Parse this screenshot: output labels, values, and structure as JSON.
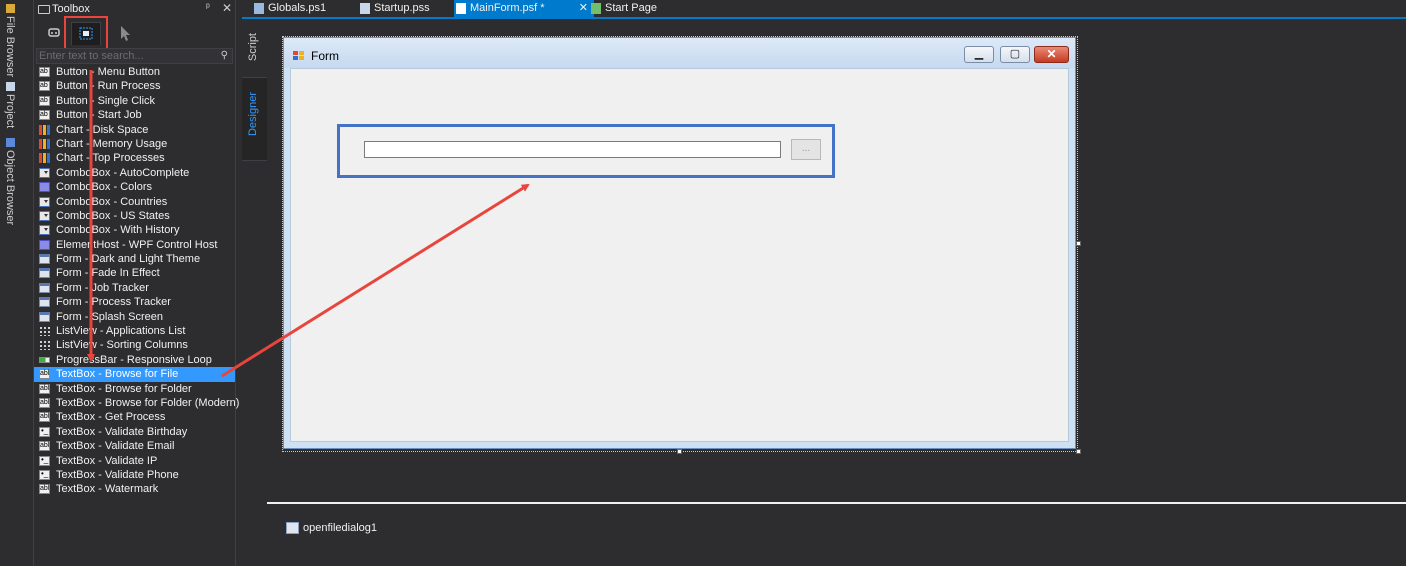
{
  "left_strip": {
    "file_browser": "File Browser",
    "project": "Project",
    "object_browser": "Object Browser"
  },
  "toolbox": {
    "title": "Toolbox",
    "pin_glyph": "ᵖ",
    "close_glyph": "✕",
    "search_placeholder": "Enter text to search...",
    "items": [
      {
        "label": "Button - Menu Button",
        "icon": "button-icon"
      },
      {
        "label": "Button - Run Process",
        "icon": "button-icon"
      },
      {
        "label": "Button - Single Click",
        "icon": "button-icon"
      },
      {
        "label": "Button - Start Job",
        "icon": "button-icon"
      },
      {
        "label": "Chart - Disk Space",
        "icon": "chart-icon"
      },
      {
        "label": "Chart - Memory Usage",
        "icon": "chart-icon"
      },
      {
        "label": "Chart - Top Processes",
        "icon": "chart-icon"
      },
      {
        "label": "ComboBox - AutoComplete",
        "icon": "combobox-icon"
      },
      {
        "label": "ComboBox - Colors",
        "icon": "combobox-color-icon"
      },
      {
        "label": "ComboBox - Countries",
        "icon": "combobox-icon"
      },
      {
        "label": "ComboBox - US States",
        "icon": "combobox-icon"
      },
      {
        "label": "ComboBox - With History",
        "icon": "combobox-icon"
      },
      {
        "label": "ElementHost - WPF Control Host",
        "icon": "combobox-color-icon"
      },
      {
        "label": "Form - Dark and Light Theme",
        "icon": "form-icon"
      },
      {
        "label": "Form - Fade In Effect",
        "icon": "form-icon"
      },
      {
        "label": "Form - Job Tracker",
        "icon": "form-icon"
      },
      {
        "label": "Form - Process Tracker",
        "icon": "form-icon"
      },
      {
        "label": "Form - Splash Screen",
        "icon": "form-icon"
      },
      {
        "label": "ListView - Applications List",
        "icon": "listview-icon"
      },
      {
        "label": "ListView - Sorting Columns",
        "icon": "listview-icon"
      },
      {
        "label": "ProgressBar - Responsive Loop",
        "icon": "progressbar-icon"
      },
      {
        "label": "TextBox - Browse for File",
        "icon": "textbox-icon",
        "selected": true
      },
      {
        "label": "TextBox - Browse for Folder",
        "icon": "textbox-icon"
      },
      {
        "label": "TextBox - Browse for Folder (Modern)",
        "icon": "textbox-icon"
      },
      {
        "label": "TextBox - Get Process",
        "icon": "textbox-icon"
      },
      {
        "label": "TextBox - Validate Birthday",
        "icon": "maskedtextbox-icon"
      },
      {
        "label": "TextBox - Validate Email",
        "icon": "textbox-icon"
      },
      {
        "label": "TextBox - Validate IP",
        "icon": "maskedtextbox-icon"
      },
      {
        "label": "TextBox - Validate Phone",
        "icon": "maskedtextbox-icon"
      },
      {
        "label": "TextBox - Watermark",
        "icon": "textbox-icon"
      }
    ]
  },
  "doc_tabs": [
    {
      "label": "Globals.ps1",
      "icon": "script-file-icon"
    },
    {
      "label": "Startup.pss",
      "icon": "hash-file-icon"
    },
    {
      "label": "MainForm.psf *",
      "icon": "form-file-icon",
      "active": true
    },
    {
      "label": "Start Page",
      "icon": "start-page-icon"
    }
  ],
  "view_tabs": {
    "script": "Script",
    "designer": "Designer"
  },
  "form": {
    "title": "Form",
    "browse_button": "...",
    "textbox_value": ""
  },
  "tray": {
    "component": "openfiledialog1"
  },
  "colors": {
    "accent": "#007acc",
    "selection": "#3399ff",
    "annotation_red": "#e8453c",
    "annotation_blue": "#4472c4"
  }
}
